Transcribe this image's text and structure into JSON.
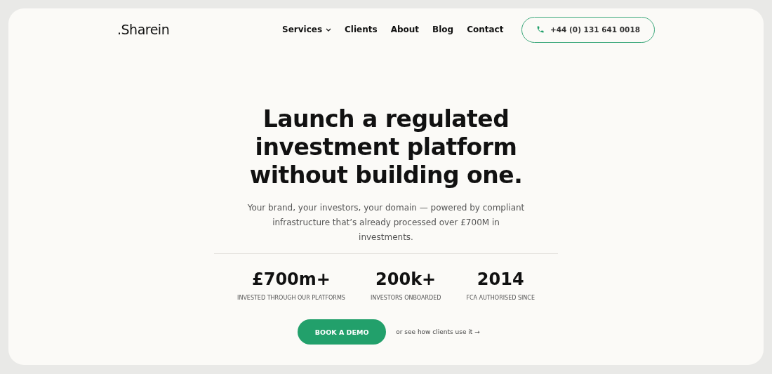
{
  "logo": ".Sharein",
  "nav": [
    {
      "label": "Services",
      "dropdown": true
    },
    {
      "label": "Clients",
      "dropdown": false
    },
    {
      "label": "About",
      "dropdown": false
    },
    {
      "label": "Blog",
      "dropdown": false
    },
    {
      "label": "Contact",
      "dropdown": false
    }
  ],
  "phone_button": "+44 (0) 131 641 0018",
  "hero": {
    "title": "Launch a regulated investment platform without building one.",
    "subtitle": "Your brand, your investors, your domain — powered by compliant infrastructure that’s already processed over £700M in investments."
  },
  "stats": [
    {
      "value": "£700m+",
      "label": "INVESTED THROUGH OUR PLATFORMS"
    },
    {
      "value": "200k+",
      "label": "INVESTORS ONBOARDED"
    },
    {
      "value": "2014",
      "label": "FCA AUTHORISED SINCE"
    }
  ],
  "cta": {
    "button": "BOOK A DEMO",
    "link": "or see how clients use it →"
  }
}
